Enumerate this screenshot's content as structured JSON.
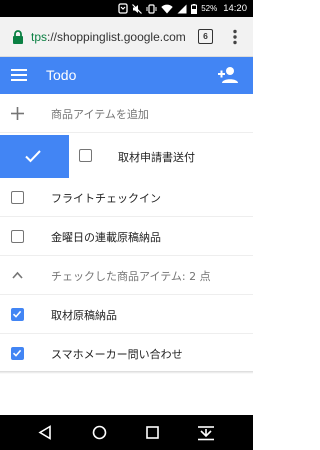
{
  "status_bar": {
    "battery": "52%",
    "time": "14:20"
  },
  "browser": {
    "url_scheme": "tps",
    "url_rest": "://shoppinglist.google.com",
    "tab_count": "6"
  },
  "app_bar": {
    "title": "Todo"
  },
  "list": {
    "add_item_placeholder": "商品アイテムを追加",
    "swiped_item": "取材申請書送付",
    "items": [
      {
        "label": "フライトチェックイン",
        "checked": false
      },
      {
        "label": "金曜日の連載原稿納品",
        "checked": false
      }
    ],
    "checked_header": "チェックした商品アイテム: 2 点",
    "checked_items": [
      {
        "label": "取材原稿納品",
        "checked": true
      },
      {
        "label": "スマホメーカー問い合わせ",
        "checked": true
      }
    ]
  },
  "colors": {
    "accent": "#4285f4",
    "secure_green": "#0b8043"
  }
}
